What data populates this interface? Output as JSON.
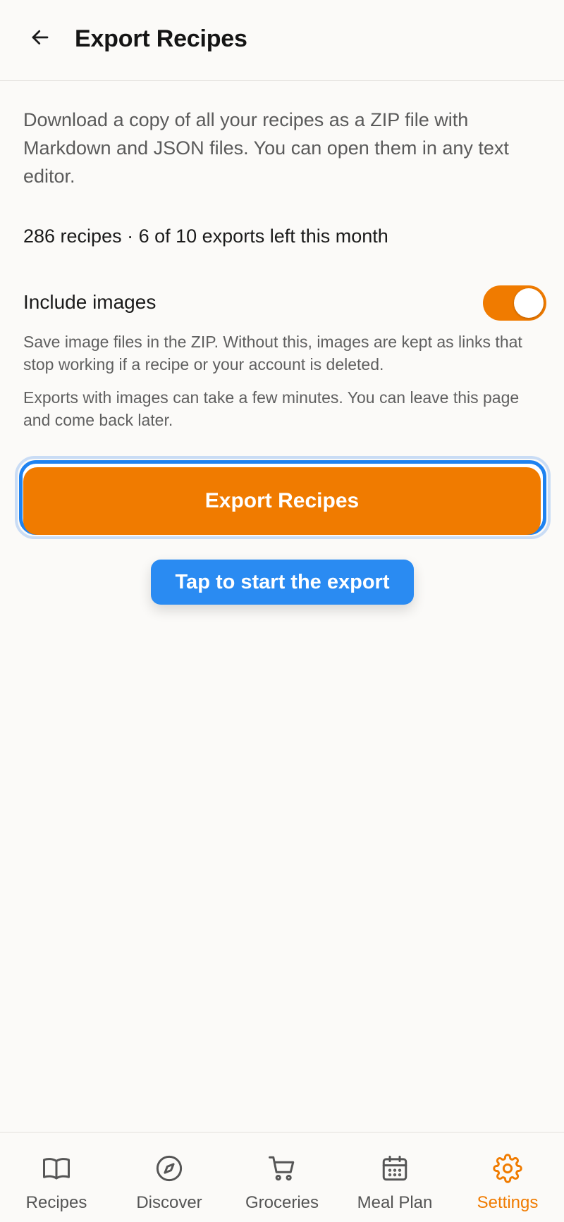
{
  "header": {
    "title": "Export Recipes",
    "back_icon": "arrow-left-icon"
  },
  "main": {
    "description": "Download a copy of all your recipes as a ZIP file with Markdown and JSON files. You can open them in any text editor.",
    "stats": "286 recipes · 6 of 10 exports left this month",
    "include_images": {
      "label": "Include images",
      "enabled": true,
      "help_primary": "Save image files in the ZIP. Without this, images are kept as links that stop working if a recipe or your account is deleted.",
      "help_secondary": "Exports with images can take a few minutes. You can leave this page and come back later."
    },
    "export_button_label": "Export Recipes",
    "tooltip": "Tap to start the export"
  },
  "nav": {
    "items": [
      {
        "label": "Recipes",
        "icon": "book-icon",
        "active": false
      },
      {
        "label": "Discover",
        "icon": "compass-icon",
        "active": false
      },
      {
        "label": "Groceries",
        "icon": "cart-icon",
        "active": false
      },
      {
        "label": "Meal Plan",
        "icon": "calendar-icon",
        "active": false
      },
      {
        "label": "Settings",
        "icon": "gear-icon",
        "active": true
      }
    ]
  },
  "colors": {
    "accent": "#f07b00",
    "focus_ring": "#1e82f0",
    "tooltip": "#2a8bf2",
    "background": "#fbfaf8"
  }
}
